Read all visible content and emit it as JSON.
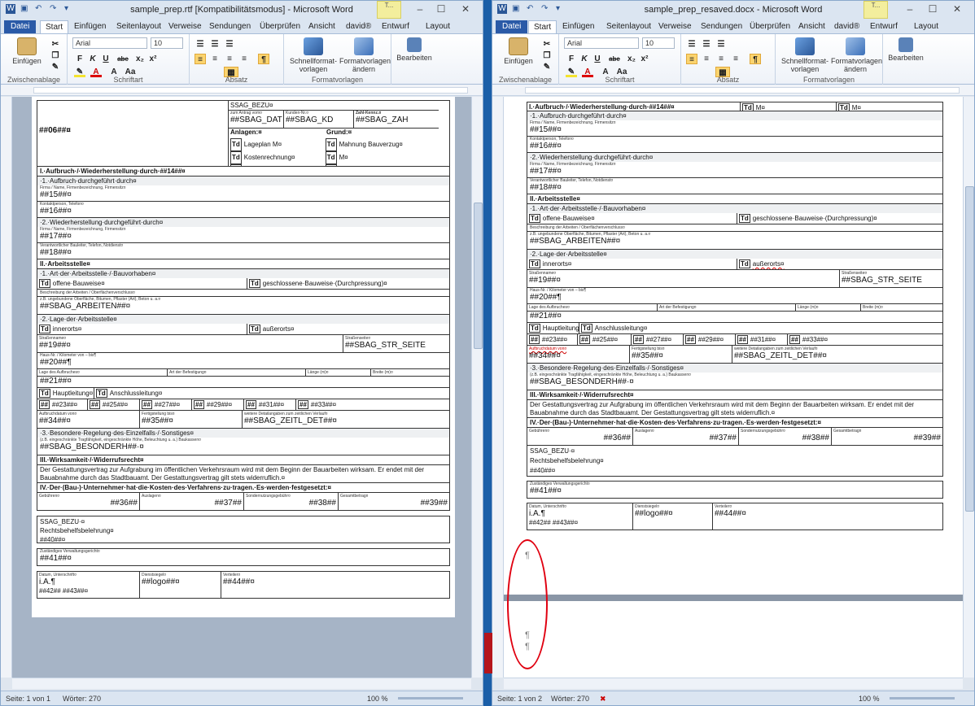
{
  "left": {
    "title": "sample_prep.rtf [Kompatibilitätsmodus] - Microsoft Word",
    "status": {
      "page": "Seite: 1 von 1",
      "words": "Wörter: 270",
      "zoom": "100 %"
    }
  },
  "right": {
    "title": "sample_prep_resaved.docx - Microsoft Word",
    "status": {
      "page": "Seite: 1 von 2",
      "words": "Wörter: 270",
      "zoom": "100 %"
    }
  },
  "tabs": [
    "Start",
    "Einfügen",
    "Seitenlayout",
    "Verweise",
    "Sendungen",
    "Überprüfen",
    "Ansicht",
    "david®"
  ],
  "tab_file": "Datei",
  "tool_tabs": [
    "Entwurf",
    "Layout"
  ],
  "tool_badge": "T...",
  "ribbon": {
    "paste": "Einfügen",
    "clipboard": "Zwischenablage",
    "font_name": "Arial",
    "font_size": "10",
    "font_group": "Schriftart",
    "para_group": "Absatz",
    "quick_styles": "Schnellformat-vorlagen",
    "change_styles": "Formatvorlagen ändern",
    "styles_group": "Formatvorlagen",
    "edit": "Bearbeiten",
    "format_buttons": [
      "F",
      "K",
      "U",
      "abe",
      "x₂",
      "x²",
      "A",
      "A",
      "Aa"
    ],
    "para_mark": "¶"
  },
  "form": {
    "header": {
      "code06": "##06##¤",
      "ssag": "SSAG_BEZU¤",
      "antrag_lbl": "zum Antrag vom¤",
      "antrag_val": "##SBAG_DAT",
      "kunden_lbl": "Kunden-Nr.¤",
      "kunden_val": "##SBAG_KD",
      "zahl_lbl": "Zahl-Kennz.¤",
      "zahl_val": "##SBAG_ZAH",
      "anlagen": "Anlagen:¤",
      "grund": "Grund:¤",
      "lageplan": "Lageplan M¤",
      "mahnung": "Mahnung Bauverzug¤",
      "kostenrechnung": "Kostenrechnung¤",
      "m1": "M¤",
      "m2": "M¤",
      "m3": "M¤",
      "td": "Td"
    },
    "s1_title": "I.·Aufbruch·/·Wiederherstellung·durch·##14##¤",
    "s1_title_left": "I.·Aufbruch·/·Wiederherstellung·durch·##14##¤",
    "s1_1": "·1.·Aufbruch·durchgeführt·durch¤",
    "firma_lbl": "Firma / Name,  Firmenbezeichnung,  Firmensitz¤",
    "v15": "##15##¤",
    "kontakt_lbl": "Kontaktperson,  Telefon¤",
    "v16": "##16##¤",
    "s1_2": "·2.·Wiederherstellung·durchgeführt·durch¤",
    "v17": "##17##¤",
    "verantw_lbl": "Verantwortlicher Bauleiter,  Telefon,  Notdienst¤",
    "v18": "##18##¤",
    "s2_title": "II.·Arbeitsstelle¤",
    "s2_1": "·1.·Art·der·Arbeitsstelle·/·Bauvorhaben¤",
    "offene": "offene·Bauweise¤",
    "geschlossene": "geschlossene·Bauweise·(Durchpressung)¤",
    "beschr_lbl": "Beschreibung der Arbeiten / Oberflächenverschluss¤",
    "zb_lbl": "z.B. ungebundene  Oberfläche,  Bitumen,  Pflaster (Art), Beton u. a.¤",
    "arbeiten": "##SBAG_ARBEITEN##¤",
    "s2_2": "·2.·Lage·der·Arbeitsstelle¤",
    "innerorts": "innerorts¤",
    "ausserorts": "außerorts¤",
    "strname_lbl": "Straßenname¤",
    "strseite_lbl": "Straßenseite¤",
    "v19": "##19##¤",
    "strseite": "##SBAG_STR_SEITE",
    "hausnr_lbl": "Haus-Nr. / Kilometer  von  ‒  bis¶",
    "v20": "##20##¶",
    "lage_lbl": "Lage des Aufbruches¤",
    "art_lbl": "Art der Befestigung¤",
    "laenge_lbl": "Länge (m)¤",
    "breite_lbl": "Breite (m)¤",
    "v21": "##21##¤",
    "hauptleitung": "Hauptleitung¤",
    "anschluss": "Anschlussleitung¤",
    "hash": "##",
    "v23": "##23##¤",
    "v25": "##25##¤",
    "v27": "##27##¤",
    "v29": "##29##¤",
    "v31": "##31##¤",
    "v33": "##33##¤",
    "aufbruch_lbl": "Aufbruchdatum  von¤",
    "fertig_lbl": "Fertigstellung bis¤",
    "weitere_lbl": "weitere Detailangaben  zum zeitlichen Verlauf¤",
    "v34": "##34##¤",
    "v35": "##35##¤",
    "zeitl": "##SBAG_ZEITL_DET##¤",
    "s2_3": "·3.·Besondere·Regelung·des·Einzelfalls·/·Sonstiges¤",
    "zb2_lbl": "(z.B. eingeschränkte  Tragfähigkeit,  eingeschränkte  Höhe,  Beleuchtung  u. a.) Baukassen¤",
    "besonder": "##SBAG_BESONDERH##·¤",
    "s3_title": "III.·Wirksamkeit·/·Widerrufsrecht¤",
    "s3_text": "Der Gestattungsvertrag zur Aufgrabung im öffentlichen Verkehrsraum wird mit dem Beginn der Bauarbeiten wirksam. Er endet mit der Bauabnahme durch das Stadtbauamt. Der Gestattungsvertrag gilt stets widerruflich.¤",
    "s4_title": "IV.·Der·(Bau-)·Unternehmer·hat·die·Kosten·des·Verfahrens·zu·tragen.·Es·werden·festgesetzt:¤",
    "gebuehren_lbl": "Gebühren¤",
    "auslagen_lbl": "Auslagen¤",
    "sondernutz_lbl": "Sondernutzungsgebühr¤",
    "gesamt_lbl": "Gesamtbetrag¤",
    "v36": "##36##",
    "v37": "##37##",
    "v38": "##38##",
    "v39": "##39##",
    "ssag2": "SSAG_BEZU·¤",
    "rechts": "Rechtsbehelfsbelehrung¤",
    "v40": "##40##¤",
    "zust_lbl": "Zuständiges  Verwaltungsgericht¤",
    "v41": "##41##¤",
    "datum_lbl": "Datum, Unterschrift¤",
    "dienst_lbl": "Dienstsiegel¤",
    "verteiler_lbl": "Verteiler¤",
    "ia": "i.A.¶",
    "v42": "##42## ##43##¤",
    "logo": "##logo##¤",
    "v44": "##44##¤"
  },
  "pilcrow": "¶"
}
